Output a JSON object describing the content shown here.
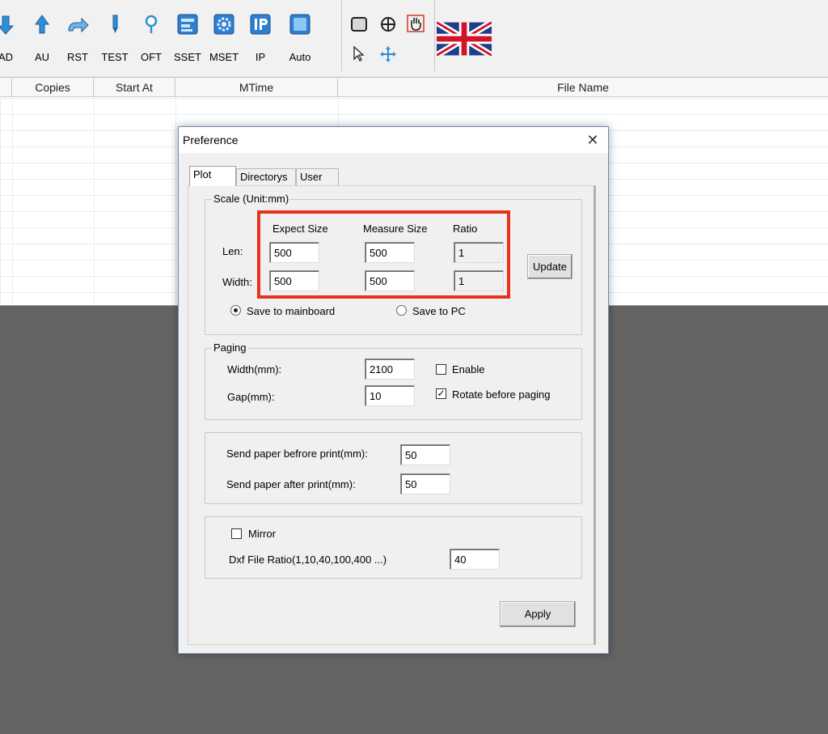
{
  "toolbar": {
    "buttons": [
      {
        "label": "AD",
        "icon": "down-arrow-icon"
      },
      {
        "label": "AU",
        "icon": "up-arrow-icon"
      },
      {
        "label": "RST",
        "icon": "reset-arrow-icon"
      },
      {
        "label": "TEST",
        "icon": "pen-test-icon"
      },
      {
        "label": "OFT",
        "icon": "offset-pin-icon"
      },
      {
        "label": "SSET",
        "icon": "system-settings-icon"
      },
      {
        "label": "MSET",
        "icon": "machine-settings-gear-icon"
      },
      {
        "label": "IP",
        "icon": "ip-icon"
      },
      {
        "label": "Auto",
        "icon": "auto-icon"
      }
    ],
    "tools": [
      "rectangle-tool-icon",
      "target-tool-icon",
      "hand-tool-icon",
      "pointer-tool-icon",
      "move-tool-icon"
    ],
    "language_flag": "uk-flag-icon"
  },
  "list": {
    "columns": [
      "Copies",
      "Start At",
      "MTime",
      "File Name"
    ]
  },
  "dialog": {
    "title": "Preference",
    "tabs": [
      "Plot",
      "Directorys",
      "User"
    ],
    "active_tab": "Plot",
    "scale": {
      "legend": "Scale (Unit:mm)",
      "col_expect": "Expect Size",
      "col_measure": "Measure Size",
      "col_ratio": "Ratio",
      "row_len_label": "Len:",
      "row_width_label": "Width:",
      "len_expect": "500",
      "len_measure": "500",
      "len_ratio": "1",
      "width_expect": "500",
      "width_measure": "500",
      "width_ratio": "1",
      "update_button": "Update",
      "save_mainboard": "Save to mainboard",
      "save_pc": "Save to PC",
      "selected_save": "Save to mainboard"
    },
    "paging": {
      "legend": "Paging",
      "width_label": "Width(mm):",
      "width_value": "2100",
      "gap_label": "Gap(mm):",
      "gap_value": "10",
      "enable_label": "Enable",
      "enable_checked": false,
      "rotate_label": "Rotate before paging",
      "rotate_checked": true
    },
    "paper": {
      "before_label": "Send paper befrore print(mm):",
      "before_value": "50",
      "after_label": "Send paper after print(mm):",
      "after_value": "50"
    },
    "misc": {
      "mirror_label": "Mirror",
      "mirror_checked": false,
      "dxf_label": "Dxf File Ratio(1,10,40,100,400 ...)",
      "dxf_value": "40"
    },
    "apply_button": "Apply",
    "close_glyph": "✕"
  },
  "colors": {
    "highlight": "#e5331f",
    "icon_blue": "#2d8fd8",
    "background": "#646464"
  }
}
